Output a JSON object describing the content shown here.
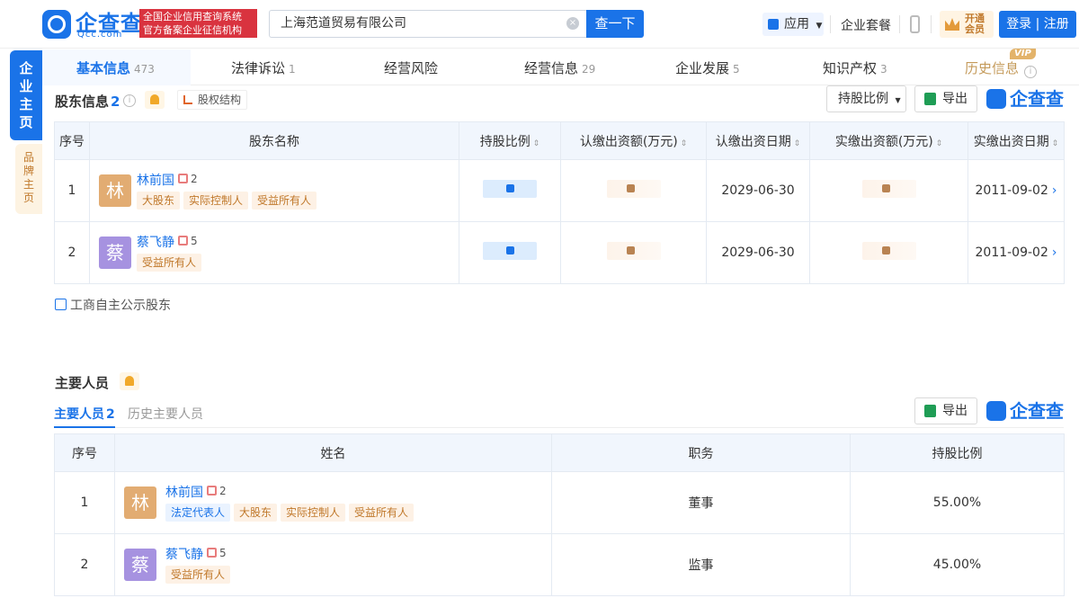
{
  "header": {
    "logo_text": "企查查",
    "logo_sub": "Qcc.com",
    "red_tag_line1": "全国企业信用查询系统",
    "red_tag_line2": "官方备案企业征信机构",
    "search_value": "上海范道贸易有限公司",
    "search_button": "查一下",
    "app_label": "应用",
    "package_label": "企业套餐",
    "vip_line1": "开通",
    "vip_line2": "会员",
    "login_label": "登录 | 注册"
  },
  "sidetabs": {
    "main": "企业主页",
    "brand": "品牌主页"
  },
  "tabs": [
    {
      "label": "基本信息",
      "count": "473"
    },
    {
      "label": "法律诉讼",
      "count": "1"
    },
    {
      "label": "经营风险",
      "count": ""
    },
    {
      "label": "经营信息",
      "count": "29"
    },
    {
      "label": "企业发展",
      "count": "5"
    },
    {
      "label": "知识产权",
      "count": "3"
    },
    {
      "label": "历史信息",
      "count": ""
    }
  ],
  "vip_badge": "VIP",
  "shareholders": {
    "title": "股东信息",
    "count": "2",
    "equity_btn": "股权结构",
    "ratio_dropdown": "持股比例",
    "export_label": "导出",
    "brand_mark": "企查查",
    "columns": [
      "序号",
      "股东名称",
      "持股比例",
      "认缴出资额(万元)",
      "认缴出资日期",
      "实缴出资额(万元)",
      "实缴出资日期"
    ],
    "rows": [
      {
        "index": "1",
        "avatar": "林",
        "name": "林前国",
        "rel_count": "2",
        "tags": [
          "大股东",
          "实际控制人",
          "受益所有人"
        ],
        "sub_date": "2029-06-30",
        "paid_date": "2011-09-02"
      },
      {
        "index": "2",
        "avatar": "蔡",
        "name": "蔡飞静",
        "rel_count": "5",
        "tags": [
          "受益所有人"
        ],
        "sub_date": "2029-06-30",
        "paid_date": "2011-09-02"
      }
    ],
    "public_link": "工商自主公示股东"
  },
  "personnel": {
    "title": "主要人员",
    "subtab_active": "主要人员",
    "subtab_active_count": "2",
    "subtab_history": "历史主要人员",
    "export_label": "导出",
    "brand_mark": "企查查",
    "columns": [
      "序号",
      "姓名",
      "职务",
      "持股比例"
    ],
    "rows": [
      {
        "index": "1",
        "avatar": "林",
        "name": "林前国",
        "rel_count": "2",
        "tags": [
          "法定代表人",
          "大股东",
          "实际控制人",
          "受益所有人"
        ],
        "role": "董事",
        "ratio": "55.00%"
      },
      {
        "index": "2",
        "avatar": "蔡",
        "name": "蔡飞静",
        "rel_count": "5",
        "tags": [
          "受益所有人"
        ],
        "role": "监事",
        "ratio": "45.00%"
      }
    ]
  }
}
